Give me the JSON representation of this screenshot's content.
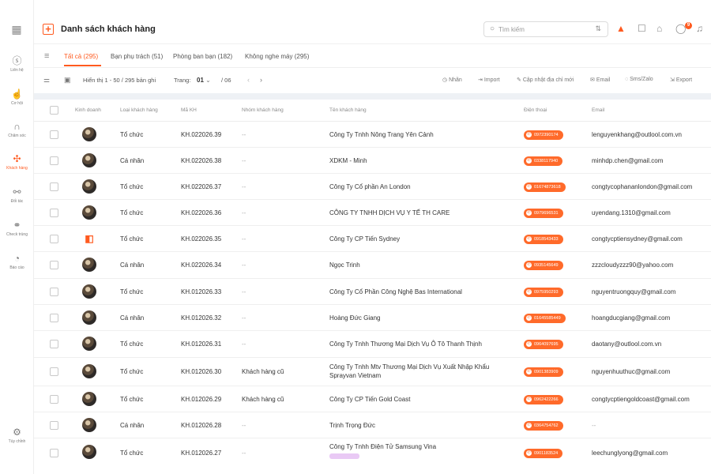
{
  "sidebar": {
    "items": [
      {
        "label": "Liên hệ",
        "icon": "contact-icon"
      },
      {
        "label": "Cơ hội",
        "icon": "opportunity-icon"
      },
      {
        "label": "Chăm sóc",
        "icon": "headset-icon"
      },
      {
        "label": "Khách hàng",
        "icon": "customers-icon"
      },
      {
        "label": "Đối tác",
        "icon": "partner-icon"
      },
      {
        "label": "Check trùng",
        "icon": "duplicate-check-icon"
      },
      {
        "label": "Báo cáo",
        "icon": "report-icon"
      },
      {
        "label": "Tùy chỉnh",
        "icon": "customize-icon"
      }
    ]
  },
  "header": {
    "title": "Danh sách khách hàng",
    "search_placeholder": "Tìm kiếm",
    "notification_count": "9"
  },
  "tabs": [
    {
      "label": "Tất cả (295)"
    },
    {
      "label": "Bạn phụ trách (51)"
    },
    {
      "label": "Phòng ban bạn (182)"
    },
    {
      "label": "Không nghe máy (295)"
    }
  ],
  "toolbar": {
    "showing": "Hiển thị 1 - 50 / 295 bản ghi",
    "page_label": "Trang:",
    "page_current": "01",
    "page_total": "/ 06",
    "actions": [
      "Nhãn",
      "Import",
      "Cập nhật địa chỉ mới",
      "Email",
      "Sms/Zalo",
      "Export"
    ]
  },
  "table": {
    "columns": [
      "Kinh doanh",
      "Loại khách hàng",
      "Mã KH",
      "Nhóm khách hàng",
      "Tên khách hàng",
      "Điện thoại",
      "Email"
    ],
    "rows": [
      {
        "type": "Tổ chức",
        "code": "KH.022026.39",
        "group": "--",
        "name": "Công Ty Tnhh Nông Trang Yên Cảnh",
        "phone": "0972390174",
        "email": "lenguyenkhang@outlool.com.vn"
      },
      {
        "type": "Cá nhân",
        "code": "KH.022026.38",
        "group": "--",
        "name": "XDKM - Minh",
        "phone": "0338117940",
        "email": "minhdp.chen@gmail.com"
      },
      {
        "type": "Tổ chức",
        "code": "KH.022026.37",
        "group": "--",
        "name": "Công Ty Cổ phần An London",
        "phone": "01674873618",
        "email": "congtycophananlondon@gmail.com"
      },
      {
        "type": "Tổ chức",
        "code": "KH.022026.36",
        "group": "--",
        "name": "CÔNG TY TNHH DỊCH VỤ Y TẾ TH CARE",
        "phone": "0979696531",
        "email": "uyendang.1310@gmail.com"
      },
      {
        "type": "Tổ chức",
        "code": "KH.022026.35",
        "group": "--",
        "name": "Công Ty CP Tiến Sydney",
        "phone": "0918543433",
        "email": "congtycptiensydney@gmail.com"
      },
      {
        "type": "Cá nhân",
        "code": "KH.022026.34",
        "group": "--",
        "name": "Ngọc Trinh",
        "phone": "0935145649",
        "email": "zzzcloudyzzz90@yahoo.com"
      },
      {
        "type": "Tổ chức",
        "code": "KH.012026.33",
        "group": "--",
        "name": "Công Ty Cổ Phần Công Nghệ Bas International",
        "phone": "0975950293",
        "email": "nguyentruongquy@gmail.com"
      },
      {
        "type": "Cá nhân",
        "code": "KH.012026.32",
        "group": "--",
        "name": "Hoàng Đức Giang",
        "phone": "01645585449",
        "email": "hoangducgiang@gmail.com"
      },
      {
        "type": "Tổ chức",
        "code": "KH.012026.31",
        "group": "--",
        "name": "Công Ty Tnhh Thương Mại Dịch Vụ Ô Tô Thanh Thịnh",
        "phone": "0964097695",
        "email": "daotany@outlool.com.vn"
      },
      {
        "type": "Tổ chức",
        "code": "KH.012026.30",
        "group": "Khách hàng cũ",
        "name": "Công Ty Tnhh Mtv Thương Mại Dịch Vụ Xuất Nhập Khẩu Sprayvan Vietnam",
        "phone": "0901383909",
        "email": "nguyenhuuthuc@gmail.com"
      },
      {
        "type": "Tổ chức",
        "code": "KH.012026.29",
        "group": "Khách hàng cũ",
        "name": "Công Ty CP Tiến Gold Coast",
        "phone": "0962422266",
        "email": "congtycptiengoldcoast@gmail.com"
      },
      {
        "type": "Cá nhân",
        "code": "KH.012026.28",
        "group": "--",
        "name": "Trịnh Trọng Đức",
        "phone": "0364754762",
        "email": "--"
      },
      {
        "type": "Tổ chức",
        "code": "KH.012026.27",
        "group": "--",
        "name": "Công Ty Tnhh Điện Tử Samsung Vina",
        "phone": "0901183524",
        "email": "leechunglyong@gmail.com"
      }
    ]
  },
  "colors": {
    "accent": "#ff5a1f",
    "phone_pill": "#ff6a2a"
  }
}
